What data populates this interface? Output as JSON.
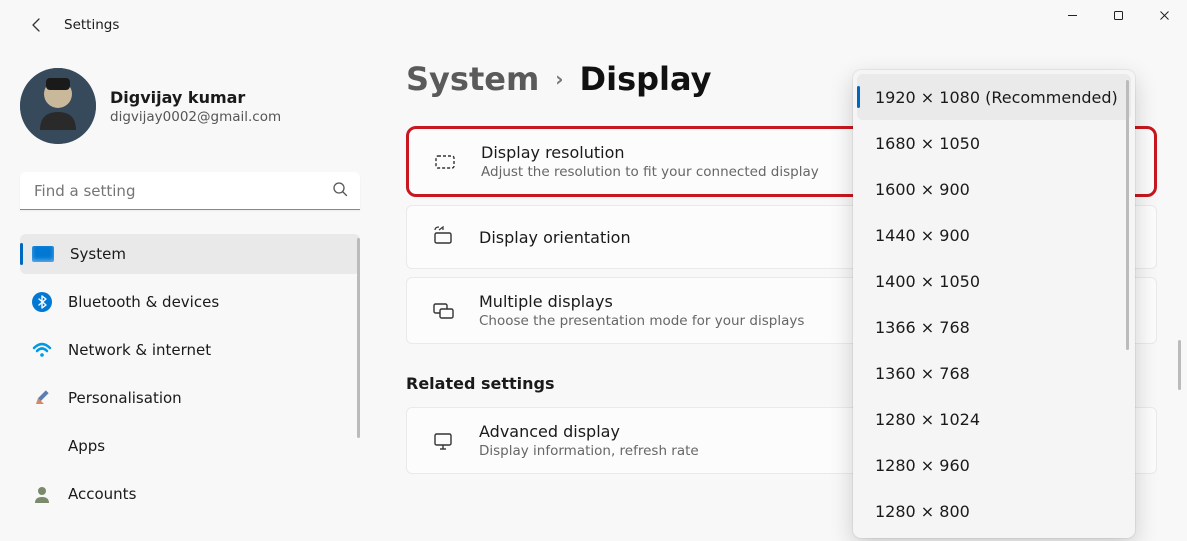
{
  "app_title": "Settings",
  "window_controls": {
    "minimize": "Minimize",
    "maximize": "Maximize",
    "close": "Close"
  },
  "user": {
    "name": "Digvijay kumar",
    "email": "digvijay0002@gmail.com"
  },
  "search": {
    "placeholder": "Find a setting"
  },
  "sidebar": {
    "items": [
      {
        "label": "System"
      },
      {
        "label": "Bluetooth & devices"
      },
      {
        "label": "Network & internet"
      },
      {
        "label": "Personalisation"
      },
      {
        "label": "Apps"
      },
      {
        "label": "Accounts"
      }
    ],
    "active_index": 0
  },
  "breadcrumb": {
    "parent": "System",
    "current": "Display"
  },
  "settings_rows": {
    "resolution": {
      "title": "Display resolution",
      "sub": "Adjust the resolution to fit your connected display"
    },
    "orientation": {
      "title": "Display orientation"
    },
    "multiple": {
      "title": "Multiple displays",
      "sub": "Choose the presentation mode for your displays"
    }
  },
  "section_heading": "Related settings",
  "advanced": {
    "title": "Advanced display",
    "sub": "Display information, refresh rate"
  },
  "resolution_dropdown": {
    "selected_index": 0,
    "options": [
      "1920 × 1080 (Recommended)",
      "1680 × 1050",
      "1600 × 900",
      "1440 × 900",
      "1400 × 1050",
      "1366 × 768",
      "1360 × 768",
      "1280 × 1024",
      "1280 × 960",
      "1280 × 800"
    ]
  }
}
